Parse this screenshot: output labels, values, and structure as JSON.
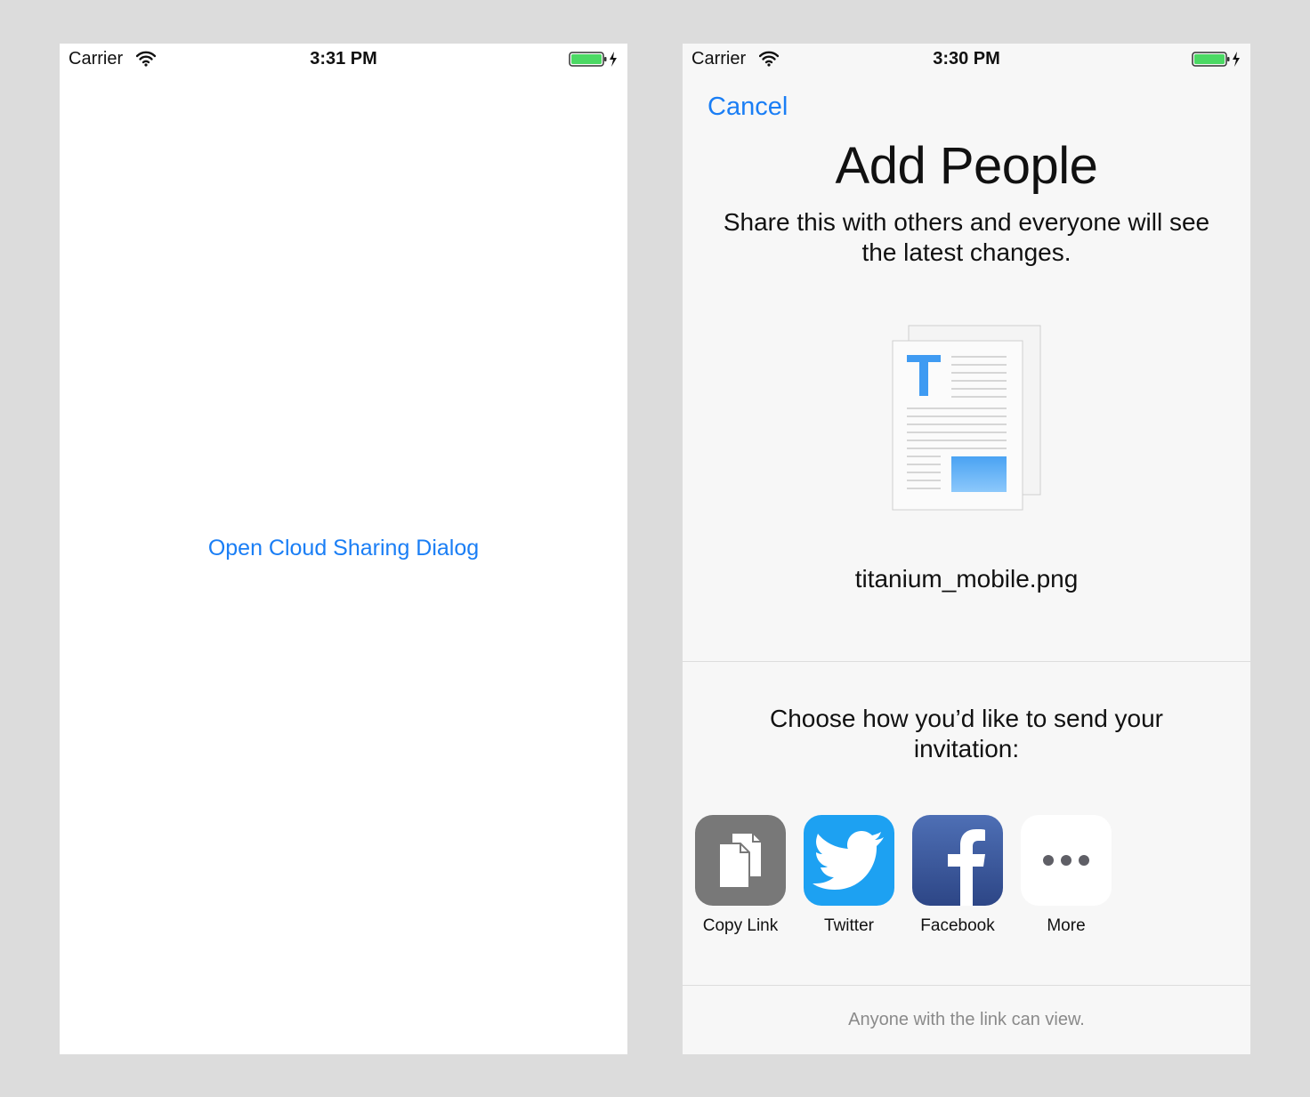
{
  "left_screen": {
    "status": {
      "carrier": "Carrier",
      "time": "3:31 PM"
    },
    "open_button_label": "Open Cloud Sharing Dialog"
  },
  "right_screen": {
    "status": {
      "carrier": "Carrier",
      "time": "3:30 PM"
    },
    "cancel_label": "Cancel",
    "title": "Add People",
    "subtitle": "Share this with others and everyone will see the latest changes.",
    "document_icon": "text-document-icon",
    "filename": "titanium_mobile.png",
    "choose_text": "Choose how you’d like to send your invitation:",
    "share_options": [
      {
        "label": "Copy Link",
        "icon": "copy-link-icon"
      },
      {
        "label": "Twitter",
        "icon": "twitter-icon"
      },
      {
        "label": "Facebook",
        "icon": "facebook-icon"
      },
      {
        "label": "More",
        "icon": "more-icon"
      }
    ],
    "footer": "Anyone with the link can view."
  },
  "colors": {
    "accent": "#1a7ef5",
    "battery": "#4cd964",
    "twitter": "#1da1f2",
    "facebook": "#3b5998",
    "copy_tile": "#787878"
  }
}
